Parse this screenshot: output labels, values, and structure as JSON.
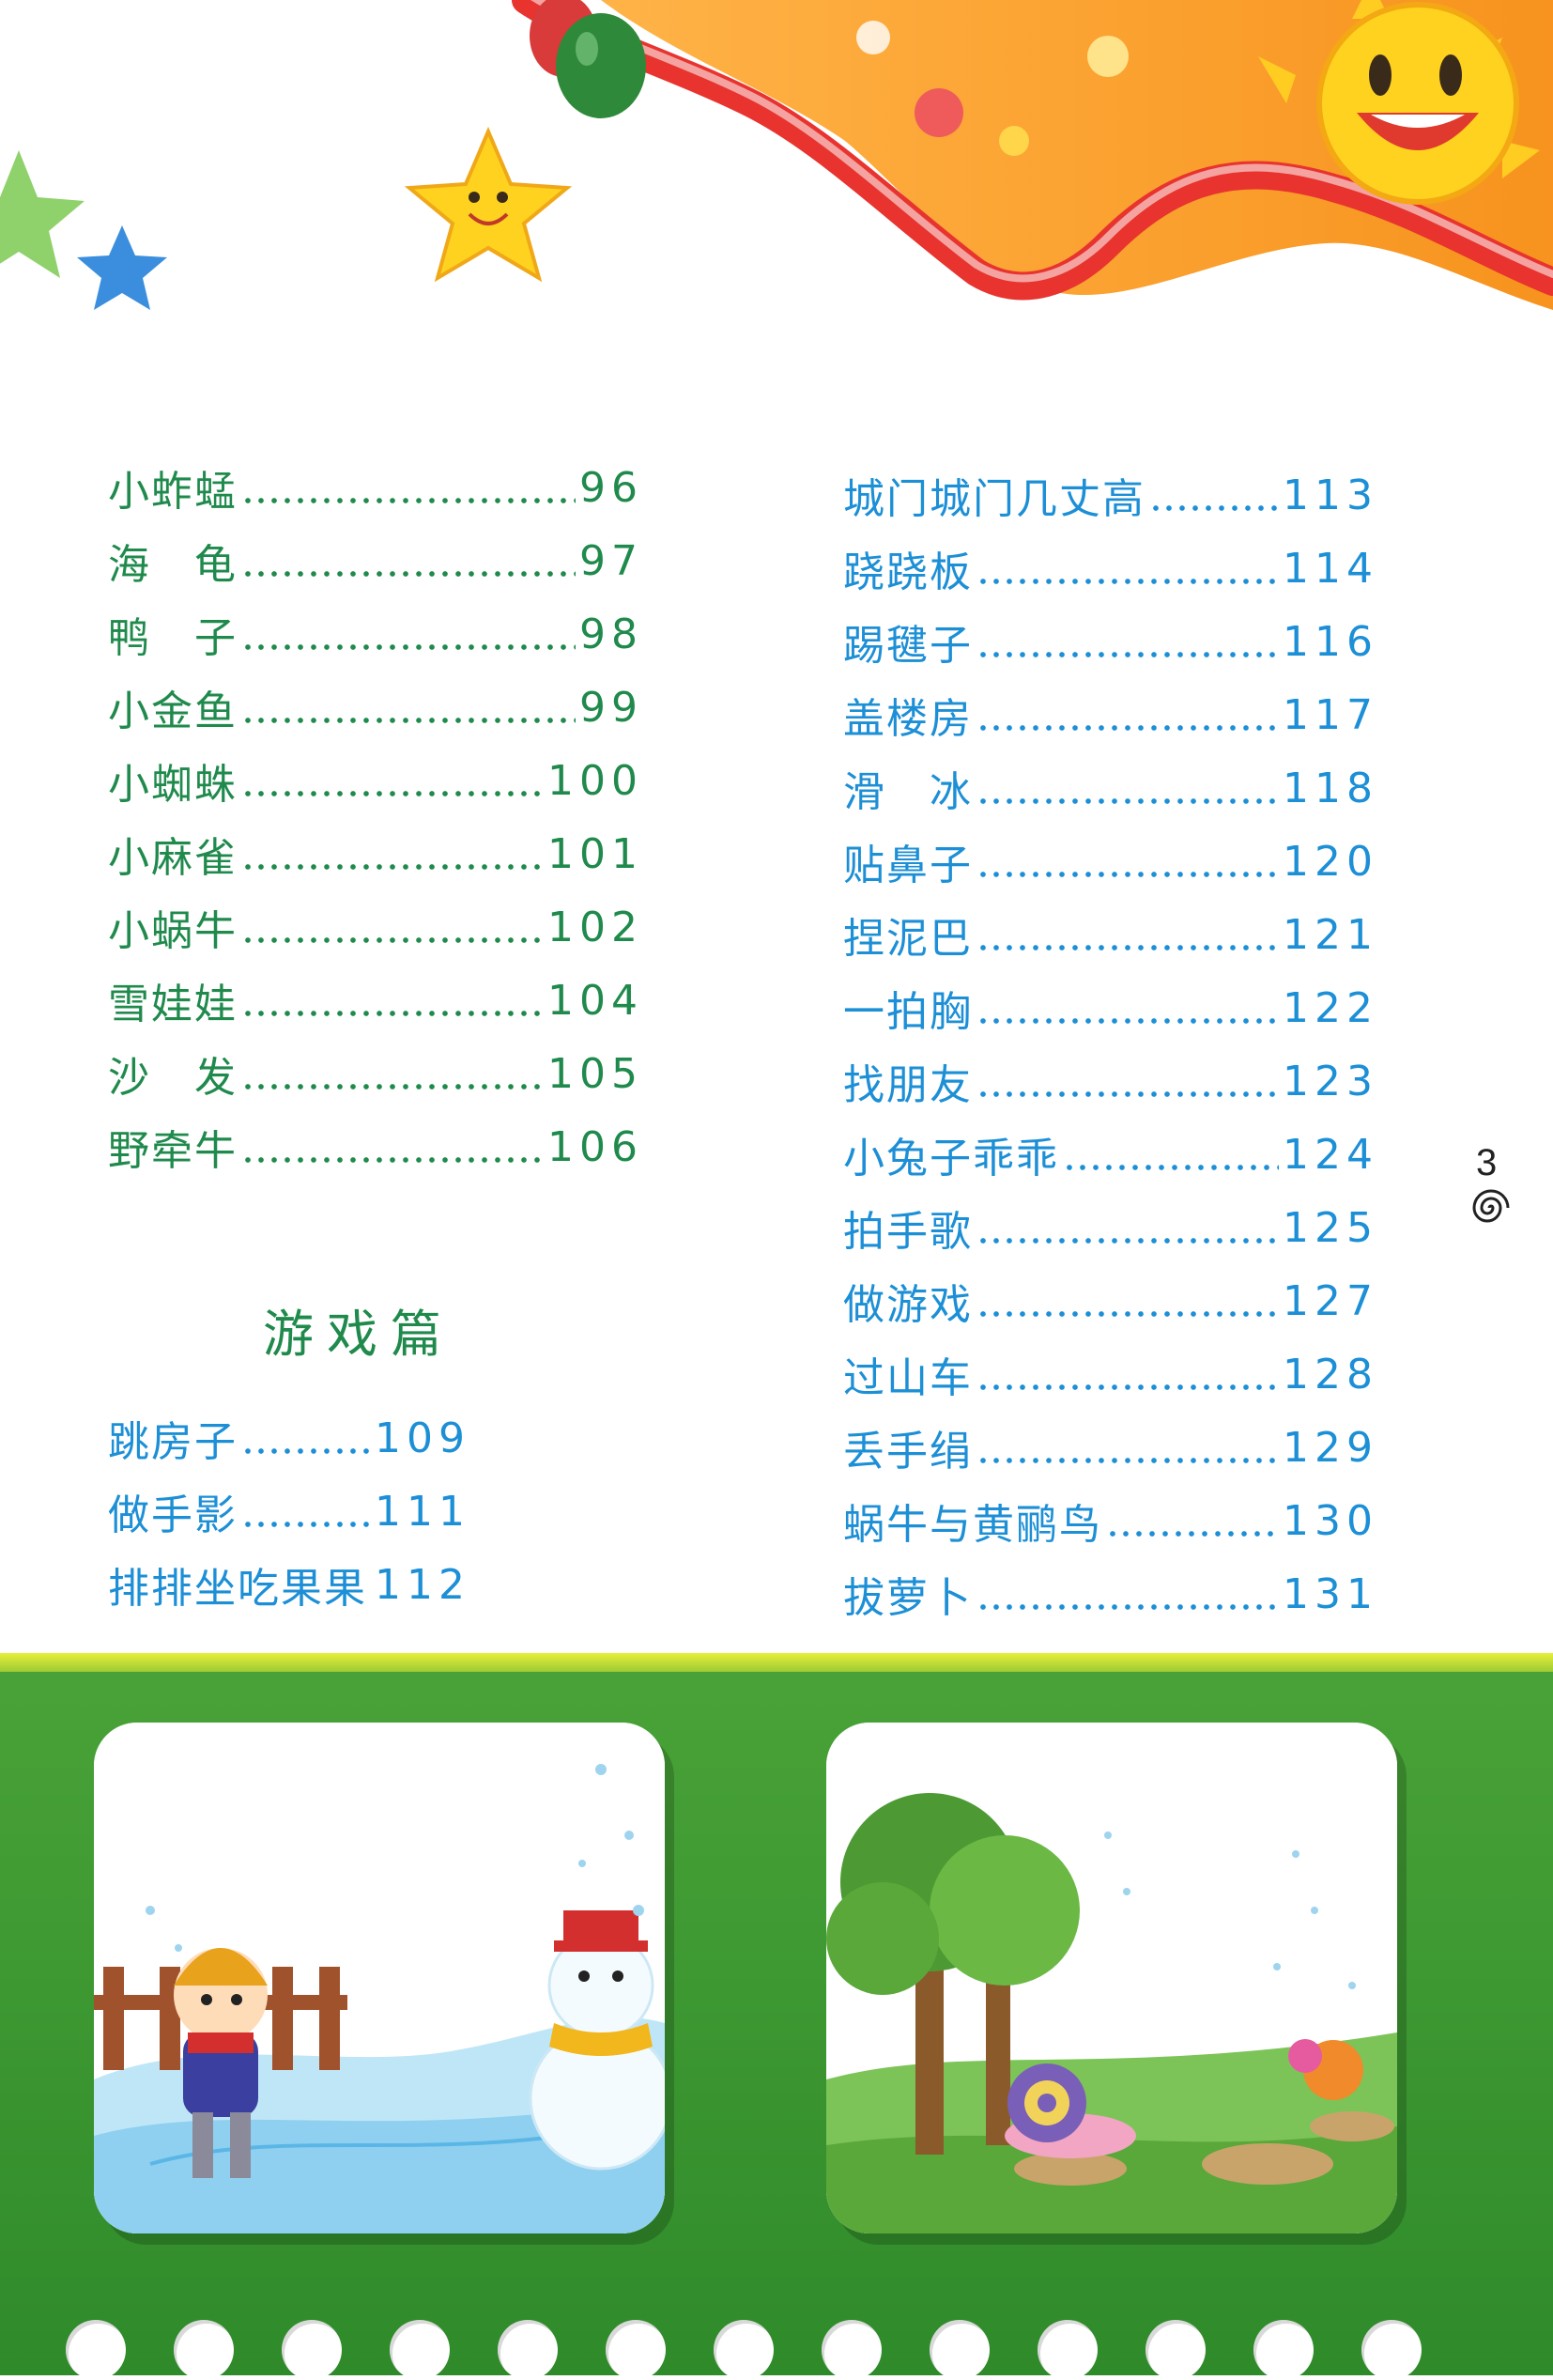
{
  "toc_left": [
    {
      "title": "小蚱蜢",
      "page": "96"
    },
    {
      "title": "海　龟",
      "page": "97"
    },
    {
      "title": "鸭　子",
      "page": "98"
    },
    {
      "title": "小金鱼",
      "page": "99"
    },
    {
      "title": "小蜘蛛",
      "page": "100"
    },
    {
      "title": "小麻雀",
      "page": "101"
    },
    {
      "title": "小蜗牛",
      "page": "102"
    },
    {
      "title": "雪娃娃",
      "page": "104"
    },
    {
      "title": "沙　发",
      "page": "105"
    },
    {
      "title": "野牵牛",
      "page": "106"
    }
  ],
  "section_heading": "游戏篇",
  "toc_games_left": [
    {
      "title": "跳房子",
      "page": "109"
    },
    {
      "title": "做手影",
      "page": "111"
    },
    {
      "title": "排排坐吃果果",
      "page": "112"
    }
  ],
  "toc_right": [
    {
      "title": "城门城门几丈高",
      "page": "113"
    },
    {
      "title": "跷跷板",
      "page": "114"
    },
    {
      "title": "踢毽子",
      "page": "116"
    },
    {
      "title": "盖楼房",
      "page": "117"
    },
    {
      "title": "滑　冰",
      "page": "118"
    },
    {
      "title": "贴鼻子",
      "page": "120"
    },
    {
      "title": "捏泥巴",
      "page": "121"
    },
    {
      "title": "一拍胸",
      "page": "122"
    },
    {
      "title": "找朋友",
      "page": "123"
    },
    {
      "title": "小兔子乖乖",
      "page": "124"
    },
    {
      "title": "拍手歌",
      "page": "125"
    },
    {
      "title": "做游戏",
      "page": "127"
    },
    {
      "title": "过山车",
      "page": "128"
    },
    {
      "title": "丢手绢",
      "page": "129"
    },
    {
      "title": "蜗牛与黄鹂鸟",
      "page": "130"
    },
    {
      "title": "拔萝卜",
      "page": "131"
    }
  ],
  "page_number": "3",
  "colors": {
    "green_text": "#1f8a4c",
    "blue_text": "#1c8fd6",
    "banner_orange": "#f7931e",
    "panel_green": "#3f9a33"
  },
  "icons": [
    "sun-icon",
    "star-icon",
    "balloon-icon",
    "swirl-icon",
    "snowman-icon",
    "skater-icon",
    "tree-icon",
    "snail-icon"
  ]
}
